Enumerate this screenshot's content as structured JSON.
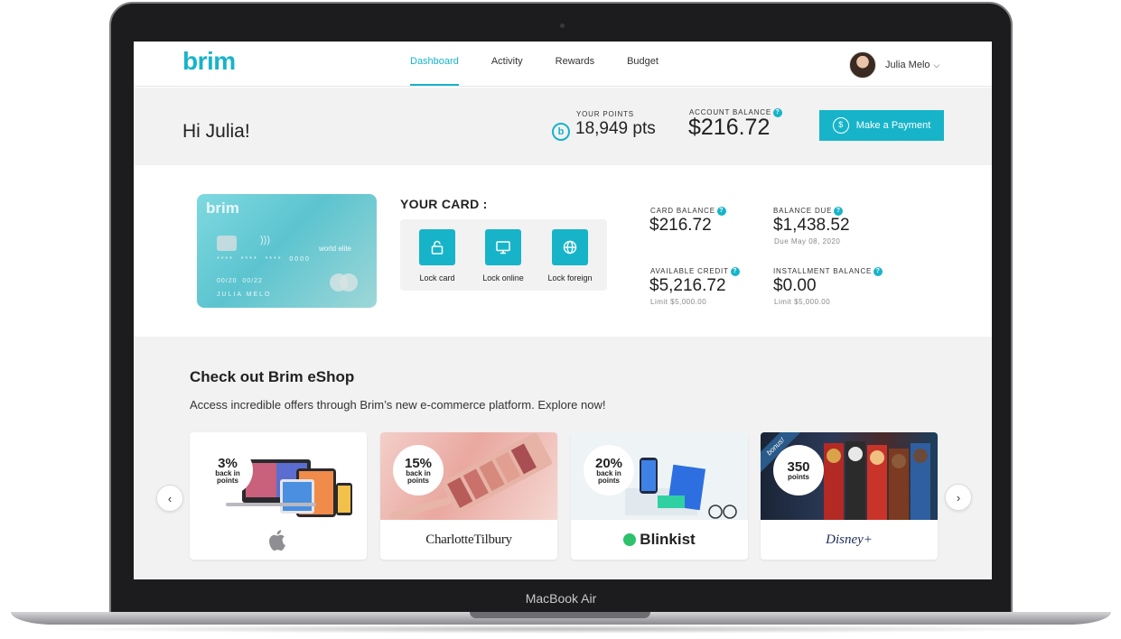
{
  "device": {
    "label": "MacBook Air"
  },
  "header": {
    "logo": "brim",
    "nav": [
      {
        "label": "Dashboard",
        "active": true
      },
      {
        "label": "Activity"
      },
      {
        "label": "Rewards"
      },
      {
        "label": "Budget"
      }
    ],
    "user_name": "Julia Melo",
    "accent_color": "#17b4c9"
  },
  "summary": {
    "greeting": "Hi Julia!",
    "points_label": "YOUR POINTS",
    "points_value": "18,949 pts",
    "points_icon_letter": "b",
    "balance_label": "ACCOUNT BALANCE",
    "balance_value": "$216.72",
    "pay_button": "Make a Payment"
  },
  "card": {
    "logo": "brim",
    "tier": "world elite",
    "number": "****  ****  ****  0000",
    "dates": "00/20  00/22",
    "holder": "JULIA MELO",
    "your_card_title": "YOUR CARD :",
    "controls": [
      {
        "label": "Lock card",
        "icon": "lock-icon"
      },
      {
        "label": "Lock online",
        "icon": "monitor-icon"
      },
      {
        "label": "Lock foreign",
        "icon": "globe-icon"
      }
    ]
  },
  "stats": {
    "card_balance_label": "CARD BALANCE",
    "card_balance_value": "$216.72",
    "balance_due_label": "BALANCE DUE",
    "balance_due_value": "$1,438.52",
    "balance_due_sub": "Due May 08, 2020",
    "available_credit_label": "AVAILABLE CREDIT",
    "available_credit_value": "$5,216.72",
    "available_credit_sub": "Limit $5,000.00",
    "installment_label": "INSTALLMENT BALANCE",
    "installment_value": "$0.00",
    "installment_sub": "Limit $5,000.00"
  },
  "eshop": {
    "title": "Check out Brim eShop",
    "description": "Access incredible offers through Brim’s new e-commerce platform. Explore now!",
    "offers": [
      {
        "big": "3%",
        "small": "back in points",
        "brand": "",
        "brand_icon": "apple-icon"
      },
      {
        "big": "15%",
        "small": "back in points",
        "brand": "CharlotteTilbury"
      },
      {
        "big": "20%",
        "small": "back in points",
        "brand": "Blinkist"
      },
      {
        "big": "350",
        "small": "points",
        "brand": "Disney+",
        "ribbon": "bonus!"
      }
    ]
  }
}
